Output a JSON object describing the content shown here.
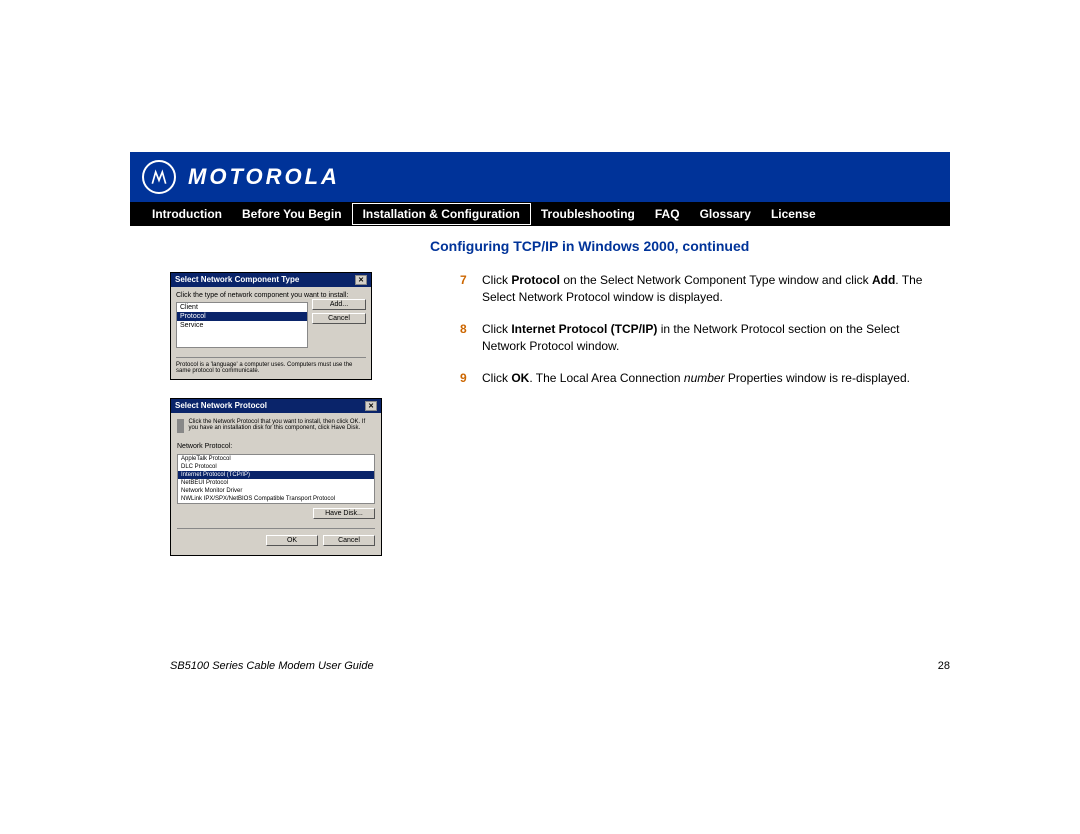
{
  "brand": "MOTOROLA",
  "nav": {
    "items": [
      {
        "label": "Introduction",
        "active": false
      },
      {
        "label": "Before You Begin",
        "active": false
      },
      {
        "label": "Installation & Configuration",
        "active": true
      },
      {
        "label": "Troubleshooting",
        "active": false
      },
      {
        "label": "FAQ",
        "active": false
      },
      {
        "label": "Glossary",
        "active": false
      },
      {
        "label": "License",
        "active": false
      }
    ]
  },
  "title": "Configuring TCP/IP in Windows 2000, continued",
  "steps": [
    {
      "num": "7",
      "html": "Click <b>Protocol</b> on the Select Network Component Type window and click <b>Add</b>. The Select Network Protocol window is displayed."
    },
    {
      "num": "8",
      "html": "Click <b>Internet Protocol (TCP/IP)</b> in the Network Protocol section on the Select Network Protocol window."
    },
    {
      "num": "9",
      "html": "Click <b>OK</b>. The Local Area Connection <i>number</i> Properties window is re-displayed."
    }
  ],
  "dlg1": {
    "title": "Select Network Component Type",
    "prompt": "Click the type of network component you want to install:",
    "items": [
      "Client",
      "Protocol",
      "Service"
    ],
    "selected": "Protocol",
    "add": "Add...",
    "cancel": "Cancel",
    "desc": "Protocol is a 'language' a computer uses. Computers must use the same protocol to communicate."
  },
  "dlg2": {
    "title": "Select Network Protocol",
    "prompt": "Click the Network Protocol that you want to install, then click OK. If you have an installation disk for this component, click Have Disk.",
    "section": "Network Protocol:",
    "items": [
      "AppleTalk Protocol",
      "DLC Protocol",
      "Internet Protocol (TCP/IP)",
      "NetBEUI Protocol",
      "Network Monitor Driver",
      "NWLink IPX/SPX/NetBIOS Compatible Transport Protocol"
    ],
    "selected": "Internet Protocol (TCP/IP)",
    "havedisk": "Have Disk...",
    "ok": "OK",
    "cancel": "Cancel"
  },
  "footer": {
    "left": "SB5100 Series Cable Modem User Guide",
    "right": "28"
  }
}
